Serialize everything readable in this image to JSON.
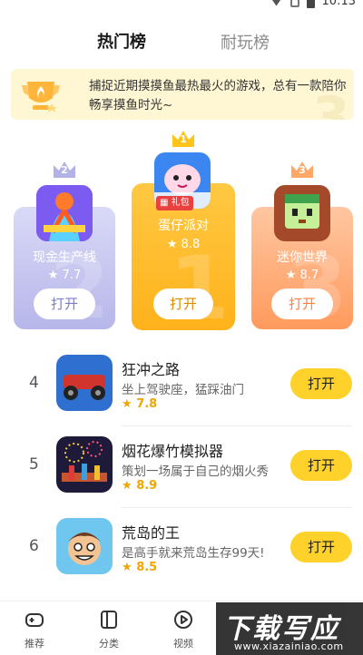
{
  "status": {
    "time": "10:13"
  },
  "tabs": [
    {
      "label": "热门榜",
      "active": true
    },
    {
      "label": "耐玩榜",
      "active": false
    }
  ],
  "banner": {
    "text": "捕捉近期摸摸鱼最热最火的游戏，总有一款陪你畅享摸鱼时光~"
  },
  "podium": [
    {
      "rank": "2",
      "name": "现金生产线",
      "rating": "7.7",
      "button": "打开",
      "color": "#b7b6ea"
    },
    {
      "rank": "1",
      "name": "蛋仔派对",
      "rating": "8.8",
      "button": "打开",
      "badge": "礼包",
      "color": "#ffb21b"
    },
    {
      "rank": "3",
      "name": "迷你世界",
      "rating": "8.7",
      "button": "打开",
      "color": "#ff9a5d"
    }
  ],
  "list": [
    {
      "rank": "4",
      "title": "狂冲之路",
      "desc": "坐上驾驶座，猛踩油门",
      "rating": "7.8",
      "button": "打开"
    },
    {
      "rank": "5",
      "title": "烟花爆竹模拟器",
      "desc": "策划一场属于自己的烟火秀",
      "rating": "8.9",
      "button": "打开"
    },
    {
      "rank": "6",
      "title": "荒岛的王",
      "desc": "是高手就来荒岛生存99天!",
      "rating": "8.5",
      "button": "打开"
    }
  ],
  "nav": [
    {
      "label": "推荐",
      "icon": "gamepad-icon"
    },
    {
      "label": "分类",
      "icon": "category-icon"
    },
    {
      "label": "视频",
      "icon": "video-icon"
    }
  ],
  "watermark": {
    "cn": "下载写应用",
    "url": "www.xiazainiao.com"
  },
  "colors": {
    "accent": "#ffd12b",
    "star": "#f0a500"
  }
}
